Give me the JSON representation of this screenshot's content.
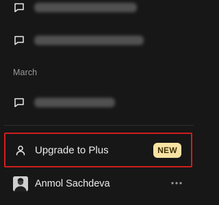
{
  "sidebar": {
    "conversations_top": [
      {
        "icon": "chat-bubble-icon",
        "title": ""
      },
      {
        "icon": "chat-bubble-icon",
        "title": ""
      }
    ],
    "section_label": "March",
    "conversations_march": [
      {
        "icon": "chat-bubble-icon",
        "title": ""
      }
    ],
    "upgrade": {
      "icon": "person-icon",
      "label": "Upgrade to Plus",
      "badge": "NEW"
    },
    "user": {
      "name": "Anmol Sachdeva",
      "more_icon": "more-horizontal-icon"
    }
  },
  "colors": {
    "background": "#171717",
    "text": "#ececec",
    "muted": "#9a9a9a",
    "highlight_border": "#d01e1e",
    "badge_bg": "#f8e3a3",
    "badge_text": "#3b2e06"
  }
}
